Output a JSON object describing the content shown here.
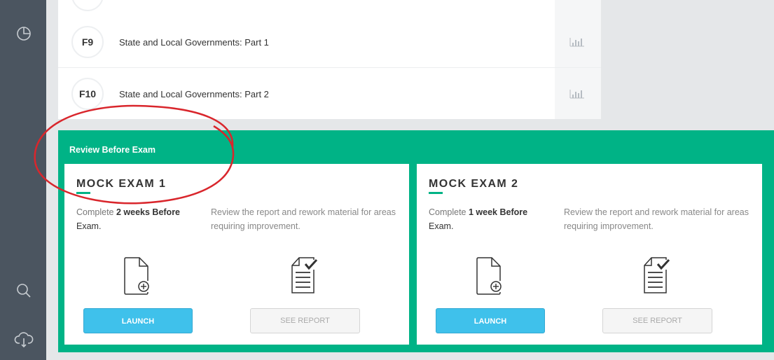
{
  "sidebar": {
    "icons": [
      "pie-chart-icon",
      "search-icon",
      "cloud-download-icon"
    ]
  },
  "lessons": [
    {
      "code": "F9",
      "title": "State and Local Governments: Part 1",
      "action_icon": "bar-chart-icon"
    },
    {
      "code": "F10",
      "title": "State and Local Governments: Part 2",
      "action_icon": "bar-chart-icon"
    }
  ],
  "review": {
    "title": "Review Before Exam",
    "cards": [
      {
        "title": "MOCK EXAM 1",
        "desc_prefix": "Complete ",
        "desc_bold": "2 weeks Before",
        "desc_end": "Exam.",
        "desc2": "Review the report and rework material for areas requiring improvement.",
        "launch_label": "LAUNCH",
        "report_label": "SEE REPORT"
      },
      {
        "title": "MOCK EXAM 2",
        "desc_prefix": "Complete ",
        "desc_bold": "1 week Before",
        "desc_end": "Exam.",
        "desc2": "Review the report and rework material for areas requiring improvement.",
        "launch_label": "LAUNCH",
        "report_label": "SEE REPORT"
      }
    ]
  },
  "colors": {
    "sidebar": "#4b5560",
    "accent_green": "#00b386",
    "launch_blue": "#3fc1eb",
    "annotation_red": "#d9262c"
  }
}
